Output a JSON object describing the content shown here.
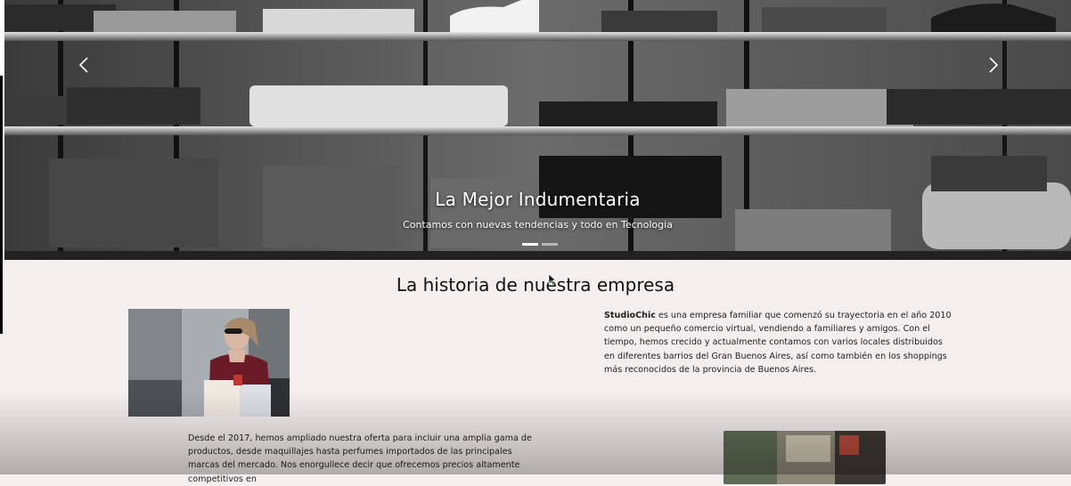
{
  "carousel": {
    "slide_title": "La Mejor Indumentaria",
    "slide_caption": "Contamos con nuevas tendencias y todo en Tecnologia",
    "prev_icon": "chevron-left-icon",
    "next_icon": "chevron-right-icon",
    "slides_count": 2,
    "active_slide": 1
  },
  "history": {
    "title": "La historia de nuestra empresa",
    "para1_brand": "StudioChic",
    "para1_text": " es una empresa familiar que comenzó su trayectoria en el año 2010 como un pequeño comercio virtual, vendiendo a familiares y amigos. Con el tiempo, hemos crecido y actualmente contamos con varios locales distribuidos en diferentes barrios del Gran Buenos Aires, así como también en los shoppings más reconocidos de la provincia de Buenos Aires.",
    "para2_text": "Desde el 2017, hemos ampliado nuestra oferta para incluir una amplia gama de productos, desde maquillajes hasta perfumes importados de las principales marcas del mercado. Nos enorgullece decir que ofrecemos precios altamente competitivos en"
  },
  "colors": {
    "page_bg": "#f4eeee",
    "text": "#222222",
    "caption_text": "#ffffff"
  }
}
